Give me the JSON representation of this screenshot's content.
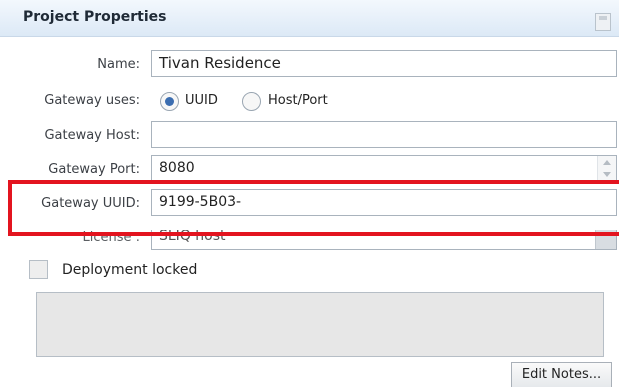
{
  "panel": {
    "title": "Project Properties"
  },
  "fields": {
    "name": {
      "label": "Name:",
      "value": "Tivan Residence"
    },
    "gateway_uses": {
      "label": "Gateway uses:",
      "options": [
        "UUID",
        "Host/Port"
      ],
      "selected": "UUID"
    },
    "gateway_host": {
      "label": "Gateway Host:",
      "value": ""
    },
    "gateway_port": {
      "label": "Gateway Port:",
      "value": "8080"
    },
    "gateway_uuid": {
      "label": "Gateway UUID:",
      "value": "9199-5B03-"
    },
    "license": {
      "label": "License :",
      "value": "SLIQ host"
    }
  },
  "deployment": {
    "label": "Deployment locked",
    "checked": false
  },
  "notes": {
    "value": "",
    "button_label": "Edit Notes..."
  },
  "colors": {
    "highlight": "#e3141f",
    "radio_selected": "#3b6db0"
  }
}
